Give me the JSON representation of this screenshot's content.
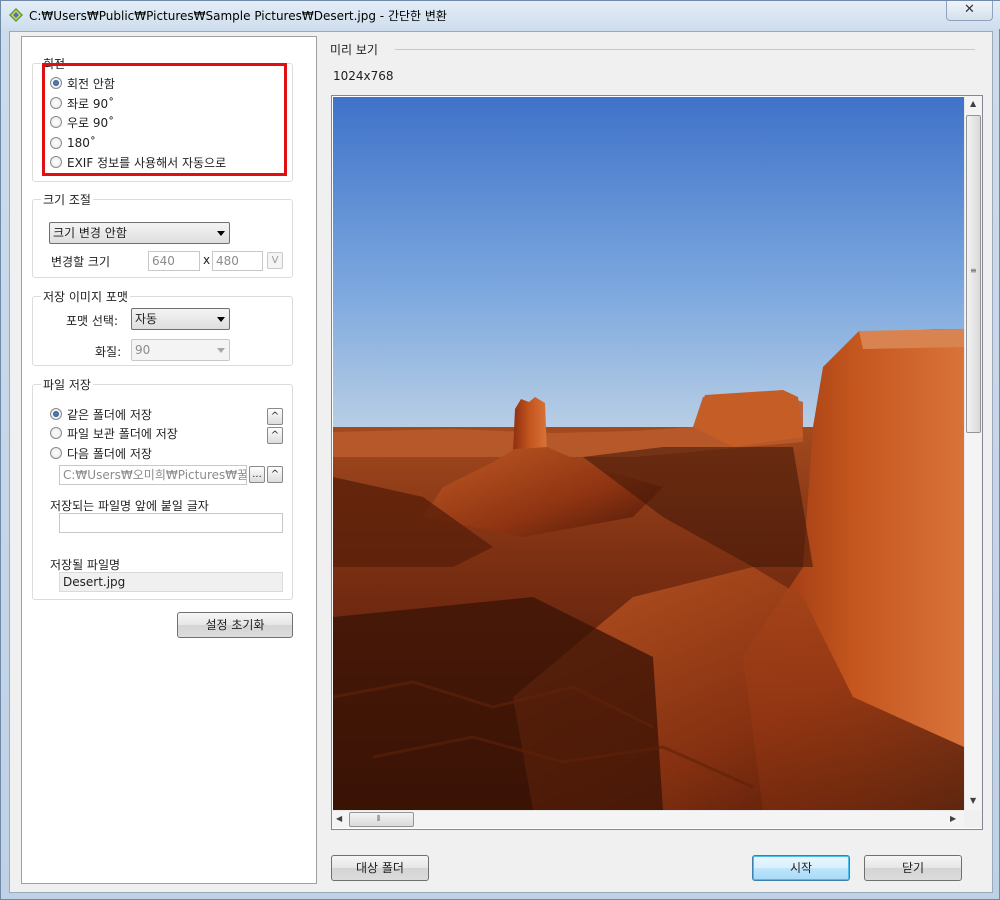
{
  "window": {
    "title": "C:₩Users₩Public₩Pictures₩Sample Pictures₩Desert.jpg - 간단한 변환",
    "close_label": "✕"
  },
  "rotation": {
    "title": "회전",
    "options": [
      "회전 안함",
      "좌로 90˚",
      "우로 90˚",
      "180˚",
      "EXIF 정보를 사용해서 자동으로"
    ],
    "selected_index": 0
  },
  "resize": {
    "title": "크기 조절",
    "mode_value": "크기 변경 안함",
    "size_label": "변경할 크기",
    "width": "640",
    "separator": "x",
    "height": "480",
    "apply_label": "V"
  },
  "format": {
    "title": "저장 이미지 포맷",
    "format_label": "포맷 선택:",
    "format_value": "자동",
    "quality_label": "화질:",
    "quality_value": "90"
  },
  "save": {
    "title": "파일 저장",
    "options": [
      "같은 폴더에 저장",
      "파일 보관 폴더에 저장",
      "다음 폴더에 저장"
    ],
    "selected_index": 0,
    "folder_path": "C:₩Users₩오미희₩Pictures₩꿀뷰",
    "browse_label": "...",
    "up_label": "^",
    "prefix_label": "저장되는 파일명 앞에 붙일 글자",
    "prefix_value": "",
    "filename_label": "저장될 파일명",
    "filename_value": "Desert.jpg"
  },
  "reset_button": "설정 초기화",
  "preview": {
    "label": "미리 보기",
    "dimensions": "1024x768",
    "image_name": "desert-photo"
  },
  "buttons": {
    "target_folder": "대상 폴더",
    "start": "시작",
    "close": "닫기"
  },
  "colors": {
    "highlight": "#e01010",
    "default_button": "#3c7fb1"
  }
}
